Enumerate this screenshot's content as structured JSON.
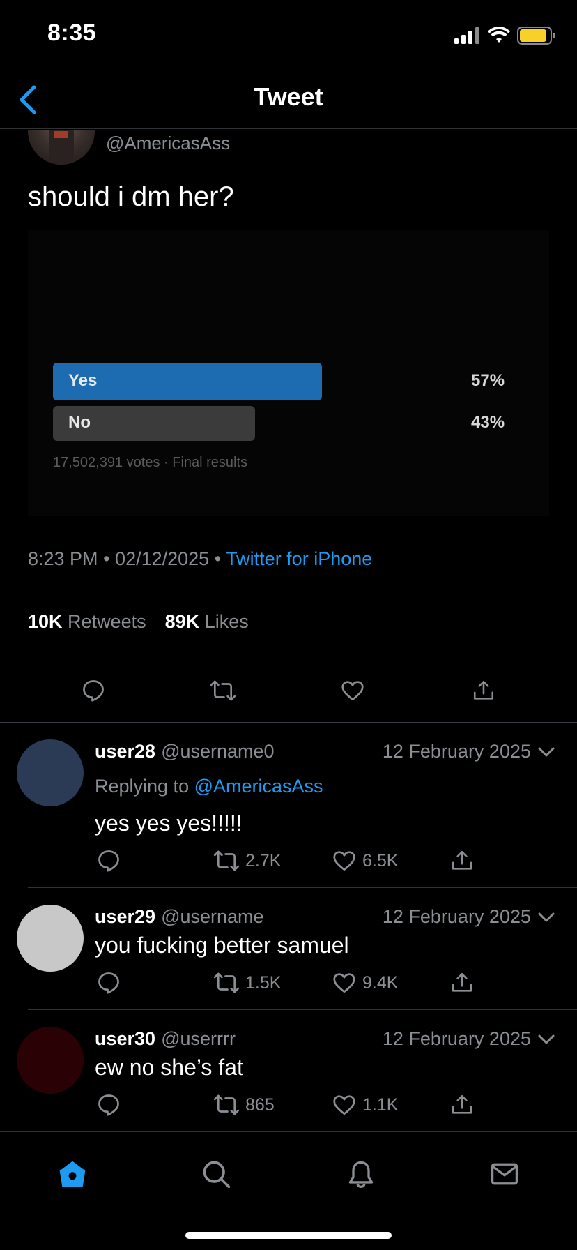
{
  "status_bar": {
    "time": "8:35"
  },
  "nav": {
    "title": "Tweet"
  },
  "tweet": {
    "handle": "@AmericasAss",
    "text": "should i dm her?",
    "poll": {
      "options": [
        {
          "label": "Yes",
          "percent": "57%",
          "fraction": 0.57
        },
        {
          "label": "No",
          "percent": "43%",
          "fraction": 0.43
        }
      ],
      "meta": "17,502,391 votes · Final results"
    },
    "time": "8:23 PM",
    "date": "02/12/2025",
    "source": "Twitter for iPhone",
    "retweets_count": "10K",
    "retweets_label": "Retweets",
    "likes_count": "89K",
    "likes_label": "Likes"
  },
  "replies": [
    {
      "name": "user28",
      "handle": "@username0",
      "date": "12 February 2025",
      "replying_prefix": "Replying to",
      "replying_to": "@AmericasAss",
      "text": "yes yes yes!!!!!",
      "retweets": "2.7K",
      "likes": "6.5K",
      "avatar_color": "#2b3a55"
    },
    {
      "name": "user29",
      "handle": "@username",
      "date": "12 February 2025",
      "text": "you fucking better samuel",
      "retweets": "1.5K",
      "likes": "9.4K",
      "avatar_color": "#c8c8c8"
    },
    {
      "name": "user30",
      "handle": "@userrrr",
      "date": "12 February 2025",
      "text": "ew no she’s fat",
      "retweets": "865",
      "likes": "1.1K",
      "avatar_color": "#2a0206"
    }
  ],
  "colors": {
    "accent": "#1d9bf0",
    "background": "#000000",
    "secondary_text": "#8b8f94"
  },
  "tabs": [
    "home-icon",
    "search-icon",
    "notifications-icon",
    "messages-icon"
  ]
}
